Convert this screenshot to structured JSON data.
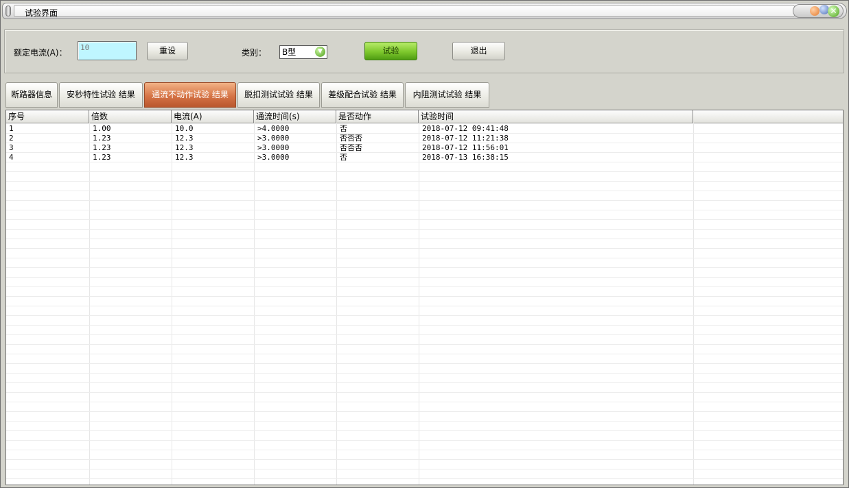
{
  "window": {
    "title": "试验界面"
  },
  "controls": {
    "rated_current_label": "额定电流(A)：",
    "rated_current_value": "10",
    "reset_label": "重设",
    "category_label": "类别：",
    "category_value": "B型",
    "test_label": "试验",
    "exit_label": "退出"
  },
  "tabs": [
    {
      "label": "断路器信息"
    },
    {
      "label": "安秒特性试验 结果"
    },
    {
      "label": "通流不动作试验 结果"
    },
    {
      "label": "脱扣测试试验 结果"
    },
    {
      "label": "差级配合试验 结果"
    },
    {
      "label": "内阻测试试验 结果"
    }
  ],
  "active_tab_index": 2,
  "table": {
    "columns": [
      "序号",
      "倍数",
      "电流(A)",
      "通流时间(s)",
      "是否动作",
      "试验时间"
    ],
    "rows": [
      [
        "1",
        "1.00",
        "10.0",
        ">4.0000",
        "否",
        "2018-07-12 09:41:48"
      ],
      [
        "2",
        "1.23",
        "12.3",
        ">3.0000",
        "否否否",
        "2018-07-12 11:21:38"
      ],
      [
        "3",
        "1.23",
        "12.3",
        ">3.0000",
        "否否否",
        "2018-07-12 11:56:01"
      ],
      [
        "4",
        "1.23",
        "12.3",
        ">3.0000",
        "否",
        "2018-07-13 16:38:15"
      ]
    ]
  },
  "colors": {
    "active_tab": "#d67446",
    "input_bg": "#bff6ff",
    "test_button": "#7dc72c"
  }
}
